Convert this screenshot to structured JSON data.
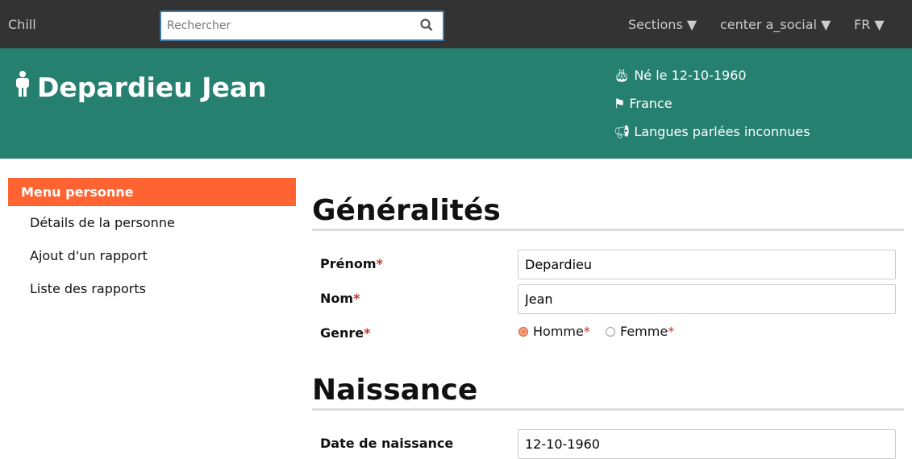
{
  "topbar": {
    "brand": "Chill",
    "search_placeholder": "Rechercher",
    "sections": "Sections ▼",
    "center": "center a_social ▼",
    "lang": "FR ▼"
  },
  "person": {
    "name": "Depardieu Jean",
    "birth": "Né le 12-10-1960",
    "country": "France",
    "languages": "Langues parlées inconnues"
  },
  "menu": {
    "title": "Menu personne",
    "items": [
      "Détails de la personne",
      "Ajout d'un rapport",
      "Liste des rapports"
    ]
  },
  "generalites": {
    "title": "Généralités",
    "prenom_label": "Prénom",
    "prenom_value": "Depardieu",
    "nom_label": "Nom",
    "nom_value": "Jean",
    "genre_label": "Genre",
    "options": [
      "Homme",
      "Femme"
    ],
    "selected": "Homme"
  },
  "naissance": {
    "title": "Naissance",
    "date_label": "Date de naissance",
    "date_value": "12-10-1960"
  },
  "colors": {
    "topbar": "#333333",
    "header": "#268070",
    "accent": "#ff6331"
  }
}
